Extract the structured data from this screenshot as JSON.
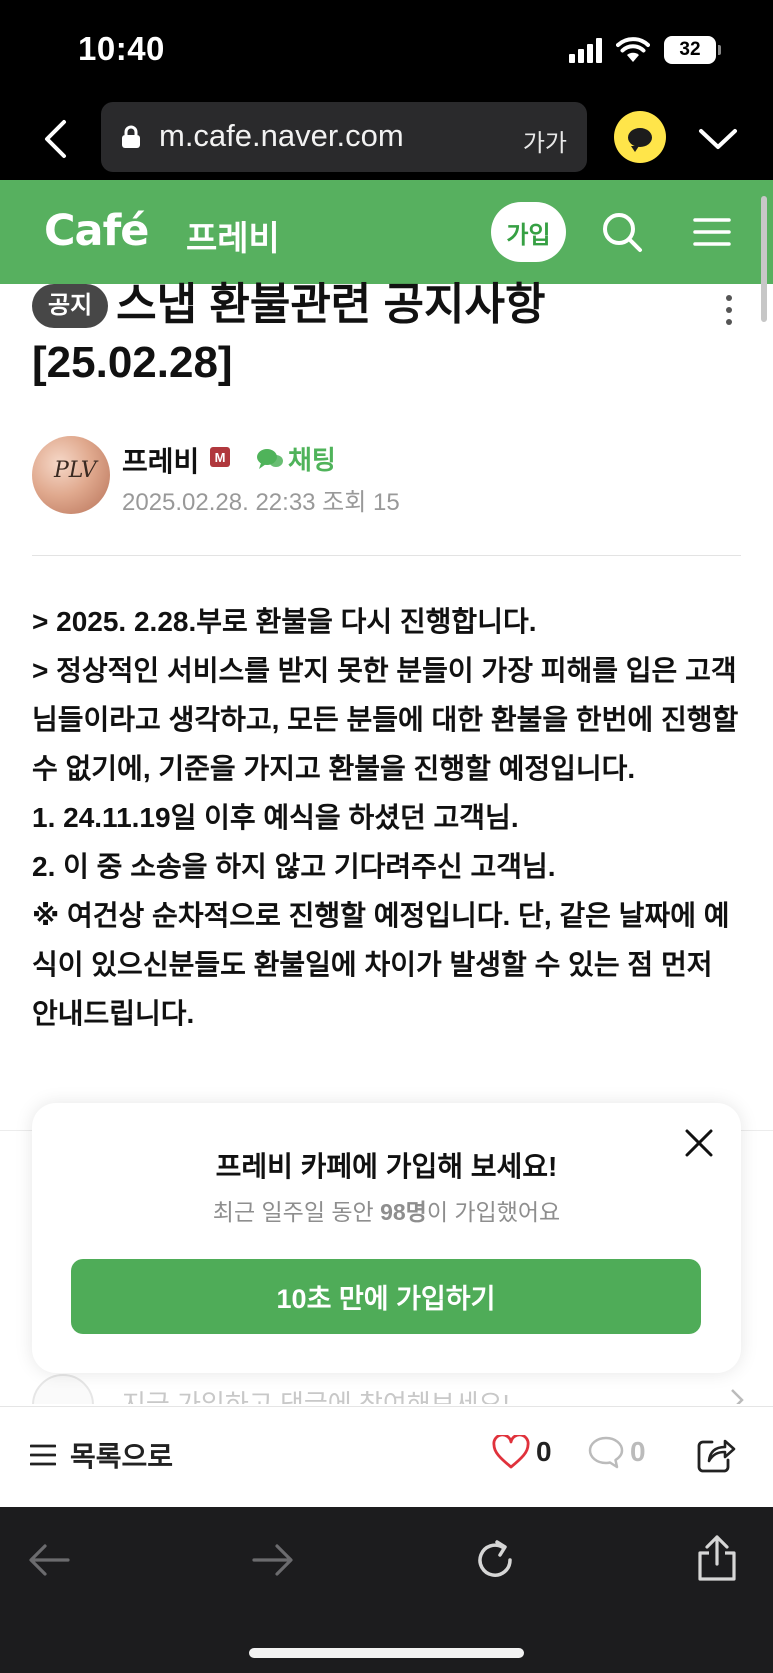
{
  "status_bar": {
    "time": "10:40",
    "battery": "32"
  },
  "browser": {
    "url": "m.cafe.naver.com",
    "text_size_label": "가가"
  },
  "cafe_header": {
    "logo": "Café",
    "cafe_name": "프레비",
    "join_label": "가입",
    "brand_color": "#57b05f"
  },
  "article": {
    "badge": "공지",
    "title": "스냅 환불관련 공지사항 [25.02.28]",
    "author": "프레비",
    "author_badge": "M",
    "chat_label": "채팅",
    "meta": "2025.02.28. 22:33  조회 15",
    "avatar_mark": "PLV",
    "body": [
      "> 2025. 2.28.부로 환불을 다시 진행합니다.",
      "> 정상적인 서비스를 받지 못한 분들이 가장 피해를 입은 고객님들이라고 생각하고, 모든 분들에 대한 환불을 한번에 진행할 수 없기에, 기준을 가지고 환불을 진행할 예정입니다.",
      "1. 24.11.19일 이후 예식을 하셨던 고객님.",
      "2. 이 중 소송을 하지 않고 기다려주신 고객님.",
      "※ 여건상 순차적으로 진행할 예정입니다. 단, 같은 날짜에 예식이 있으신분들도 환불일에 차이가 발생할 수 있는 점 먼저 안내드립니다."
    ]
  },
  "join_popup": {
    "title": "프레비 카페에 가입해 보세요!",
    "subtitle_prefix": "최근 일주일 동안 ",
    "subtitle_count": "98명",
    "subtitle_suffix": "이 가입했어요",
    "button": "10초 만에 가입하기"
  },
  "comment_prompt": "지금 가입하고 댓글에 참여해보세요!",
  "action_bar": {
    "list_label": "목록으로",
    "likes": "0",
    "comments": "0",
    "like_color": "#e0323c"
  }
}
